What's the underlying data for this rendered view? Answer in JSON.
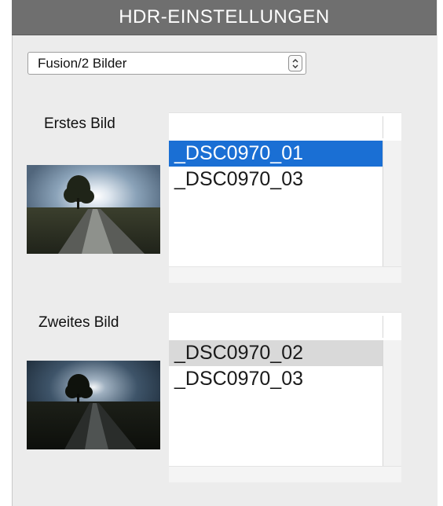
{
  "header": {
    "title": "HDR-EINSTELLUNGEN"
  },
  "mode_select": {
    "value": "Fusion/2 Bilder",
    "stepper_icon": "up-down-chevron-icon"
  },
  "first_image": {
    "label": "Erstes Bild",
    "files": [
      {
        "name": "_DSC0970_01",
        "selected": true
      },
      {
        "name": "_DSC0970_03",
        "selected": false
      }
    ]
  },
  "second_image": {
    "label": "Zweites Bild",
    "files": [
      {
        "name": "_DSC0970_02",
        "selected": true
      },
      {
        "name": "_DSC0970_03",
        "selected": false
      }
    ]
  },
  "colors": {
    "title_bar": "#6f6f6f",
    "selection_active": "#1a6fd4",
    "selection_inactive": "#d9d9d9",
    "panel_bg": "#ececec"
  }
}
